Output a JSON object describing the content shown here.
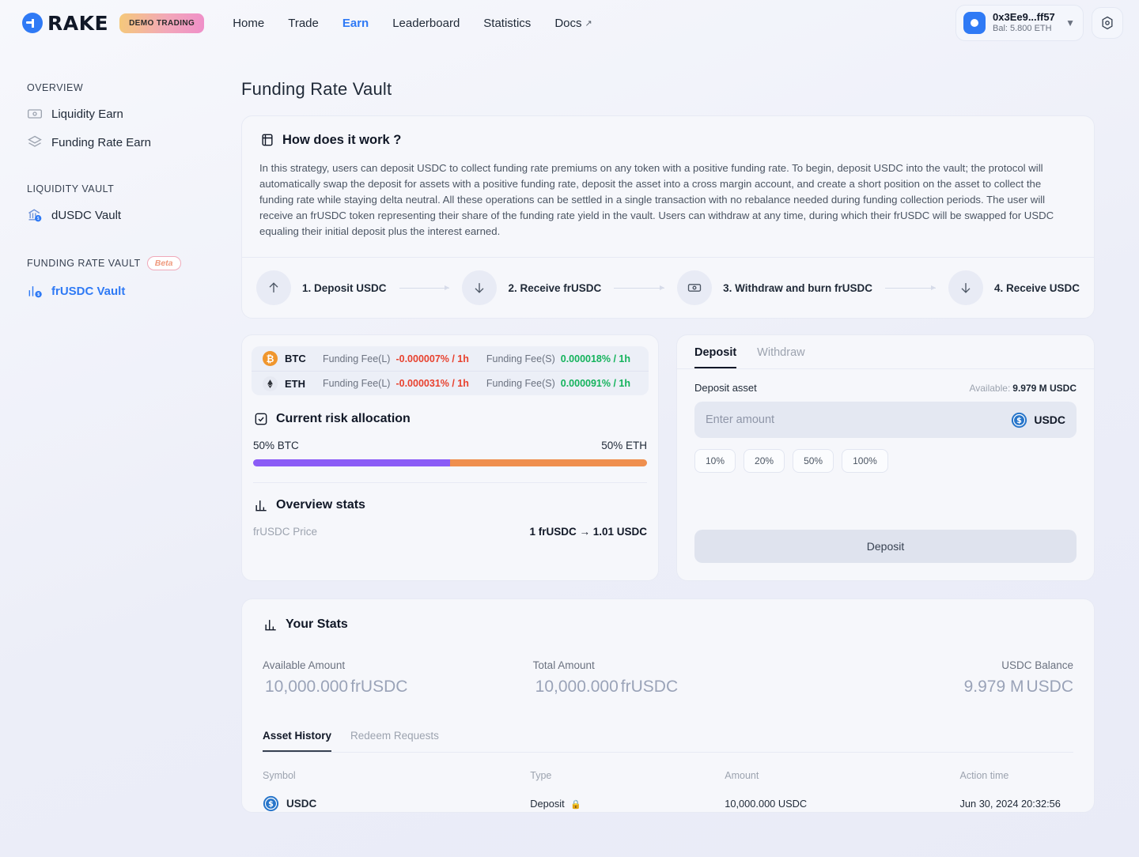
{
  "nav": {
    "brand": "RAKE",
    "demo_badge": "DEMO TRADING",
    "links": [
      {
        "label": "Home",
        "icon": "",
        "active": false
      },
      {
        "label": "Trade",
        "icon": "",
        "active": false
      },
      {
        "label": "Earn",
        "icon": "",
        "active": true
      },
      {
        "label": "Leaderboard",
        "icon": "",
        "active": false
      },
      {
        "label": "Statistics",
        "icon": "",
        "active": false
      },
      {
        "label": "Docs",
        "icon": "external-link-icon",
        "active": false
      }
    ],
    "wallet": {
      "address": "0x3Ee9...ff57",
      "balance": "Bal: 5.800 ETH",
      "avatar_icon": "wallet-avatar-icon",
      "chevron_icon": "chevron-down-icon"
    },
    "settings_icon": "gear-icon"
  },
  "sidebar": {
    "groups": [
      {
        "title": "OVERVIEW",
        "badge": null,
        "items": [
          {
            "label": "Liquidity Earn",
            "icon": "banknote-icon",
            "active": false
          },
          {
            "label": "Funding Rate Earn",
            "icon": "layers-icon",
            "active": false
          }
        ]
      },
      {
        "title": "LIQUIDITY VAULT",
        "badge": null,
        "items": [
          {
            "label": "dUSDC Vault",
            "icon": "bank-coin-icon",
            "active": false
          }
        ]
      },
      {
        "title": "FUNDING RATE VAULT",
        "badge": "Beta",
        "items": [
          {
            "label": "frUSDC Vault",
            "icon": "chart-coin-icon",
            "active": true
          }
        ]
      }
    ]
  },
  "main": {
    "page_title": "Funding Rate Vault",
    "how_it_works": {
      "icon": "book-icon",
      "title": "How does it work ?",
      "body": "In this strategy, users can deposit USDC to collect funding rate premiums on any token with a positive funding rate. To begin, deposit USDC into the vault; the protocol will automatically swap the deposit for assets with a positive funding rate, deposit the asset into a cross margin account, and create a short position on the asset to collect the funding rate while staying delta neutral. All these operations can be settled in a single transaction with no rebalance needed during funding collection periods. The user will receive an frUSDC token representing their share of the funding rate yield in the vault. Users can withdraw at any time, during which their frUSDC will be swapped for USDC equaling their initial deposit plus the interest earned.",
      "steps": [
        {
          "label": "1. Deposit USDC",
          "icon": "arrow-up-icon"
        },
        {
          "label": "2. Receive frUSDC",
          "icon": "arrow-down-icon"
        },
        {
          "label": "3. Withdraw and burn frUSDC",
          "icon": "banknote-icon"
        },
        {
          "label": "4. Receive USDC",
          "icon": "arrow-down-icon"
        }
      ]
    },
    "funding_fees": {
      "rows": [
        {
          "symbol": "BTC",
          "icon": "btc-icon",
          "long_label": "Funding Fee(L)",
          "long_value": "-0.000007% / 1h",
          "short_label": "Funding Fee(S)",
          "short_value": "0.000018% / 1h"
        },
        {
          "symbol": "ETH",
          "icon": "eth-icon",
          "long_label": "Funding Fee(L)",
          "long_value": "-0.000031% / 1h",
          "short_label": "Funding Fee(S)",
          "short_value": "0.000091% / 1h"
        }
      ]
    },
    "risk_allocation": {
      "icon": "checkbox-icon",
      "title": "Current risk allocation",
      "left_label": "50% BTC",
      "right_label": "50% ETH",
      "left_pct": 50,
      "right_pct": 50,
      "left_color": "#8b5cf6",
      "right_color": "#ef8f4e"
    },
    "overview_stats": {
      "icon": "chart-icon",
      "title": "Overview stats",
      "rows": [
        {
          "key": "frUSDC Price",
          "value": "1 frUSDC  →  1.01 USDC"
        }
      ]
    },
    "deposit_panel": {
      "tabs": [
        {
          "label": "Deposit",
          "active": true
        },
        {
          "label": "Withdraw",
          "active": false
        }
      ],
      "asset_label": "Deposit asset",
      "available_label": "Available:",
      "available_value": "9.979 M USDC",
      "amount_placeholder": "Enter amount",
      "amount_value": "",
      "asset_symbol": "USDC",
      "asset_icon": "usdc-icon",
      "percent_buttons": [
        "10%",
        "20%",
        "50%",
        "100%"
      ],
      "submit_label": "Deposit"
    },
    "your_stats": {
      "icon": "chart-icon",
      "title": "Your Stats",
      "metrics": [
        {
          "label": "Available Amount",
          "value": "10,000.000",
          "unit": "frUSDC"
        },
        {
          "label": "Total Amount",
          "value": "10,000.000",
          "unit": "frUSDC"
        },
        {
          "label": "USDC Balance",
          "value": "9.979 M",
          "unit": "USDC"
        }
      ],
      "tabs": [
        {
          "label": "Asset History",
          "active": true
        },
        {
          "label": "Redeem Requests",
          "active": false
        }
      ],
      "table": {
        "columns": [
          "Symbol",
          "Type",
          "Amount",
          "Action time"
        ],
        "rows": [
          {
            "symbol": "USDC",
            "symbol_icon": "usdc-icon",
            "type": "Deposit",
            "type_icon": "lock-icon",
            "amount": "10,000.000 USDC",
            "action_time": "Jun 30, 2024 20:32:56"
          }
        ]
      }
    }
  }
}
